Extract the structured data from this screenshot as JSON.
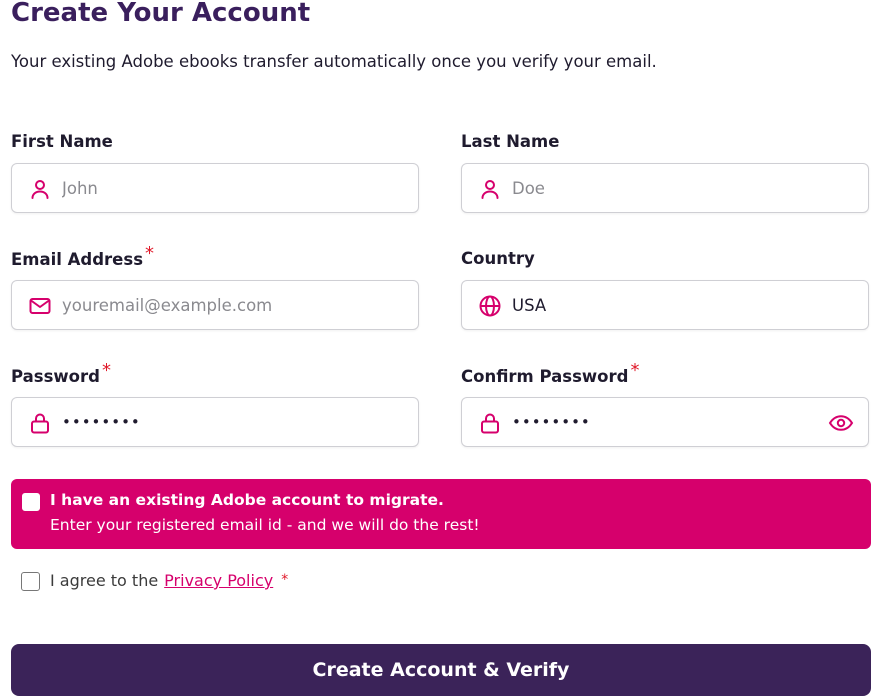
{
  "form": {
    "title": "Create Your Account",
    "subtitle": "Your existing Adobe ebooks transfer automatically once you verify your email.",
    "required_marker": "*",
    "first_name": {
      "label": "First Name",
      "placeholder": "John",
      "icon": "person-icon"
    },
    "last_name": {
      "label": "Last Name",
      "placeholder": "Doe",
      "icon": "person-icon"
    },
    "email": {
      "label": "Email Address",
      "placeholder": "youremail@example.com",
      "icon": "mail-icon",
      "required": true
    },
    "country": {
      "label": "Country",
      "value": "USA",
      "icon": "globe-icon"
    },
    "password": {
      "label": "Password",
      "value": "••••••••",
      "icon": "lock-icon",
      "required": true
    },
    "confirm_password": {
      "label": "Confirm Password",
      "value": "••••••••",
      "icon": "lock-icon",
      "toggle_icon": "eye-icon",
      "required": true
    },
    "migrate": {
      "checked": false,
      "title": "I have an existing Adobe account to migrate.",
      "description": "Enter your registered email id - and we will do the rest!"
    },
    "agree": {
      "checked": false,
      "text": "I agree to the",
      "link_text": "Privacy Policy",
      "required_marker": "*"
    },
    "submit_label": "Create Account & Verify"
  },
  "colors": {
    "accent": "#d6006c",
    "primary": "#3b2359",
    "title": "#3a1f5d",
    "required": "#e0192a"
  }
}
